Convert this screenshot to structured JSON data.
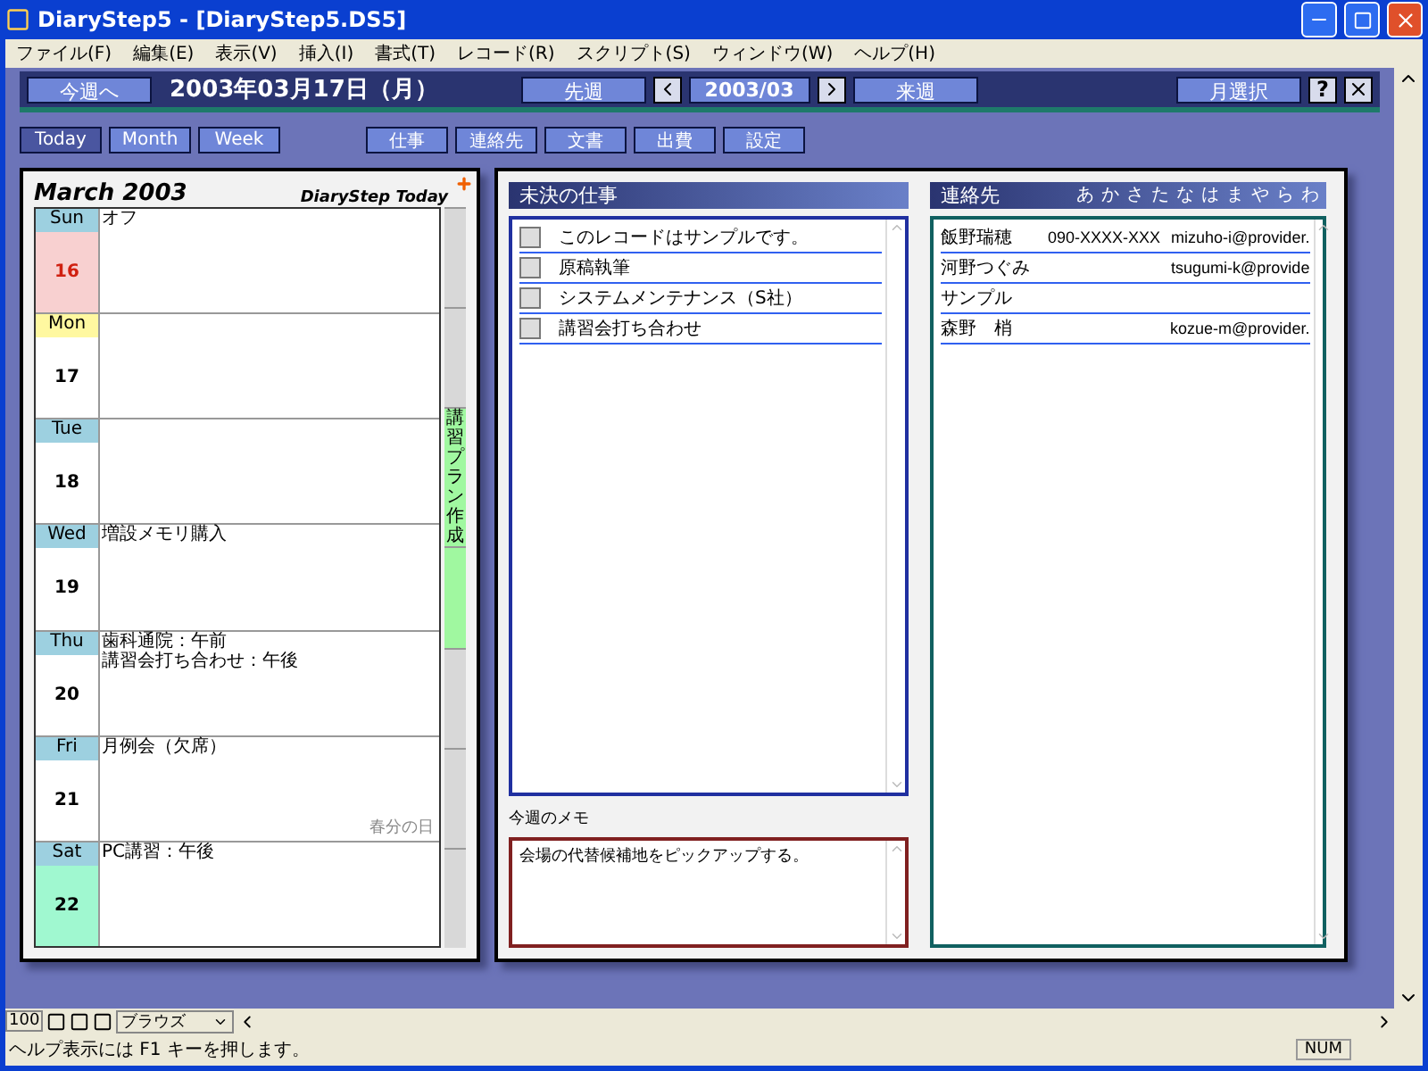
{
  "window": {
    "title": "DiaryStep5 - [DiaryStep5.DS5]"
  },
  "menu": [
    "ファイル(F)",
    "編集(E)",
    "表示(V)",
    "挿入(I)",
    "書式(T)",
    "レコード(R)",
    "スクリプト(S)",
    "ウィンドウ(W)",
    "ヘルプ(H)"
  ],
  "header": {
    "this_week": "今週へ",
    "date": "2003年03月17日（月）",
    "prev_week": "先週",
    "month": "2003/03",
    "next_week": "来週",
    "month_select": "月選択",
    "help": "?"
  },
  "view_tabs": [
    {
      "label": "Today",
      "selected": true
    },
    {
      "label": "Month",
      "selected": false
    },
    {
      "label": "Week",
      "selected": false
    }
  ],
  "sections": [
    "仕事",
    "連絡先",
    "文書",
    "出費",
    "設定"
  ],
  "calendar": {
    "title": "March 2003",
    "brand": "DiaryStep Today",
    "band_label": "講習プラン作成",
    "days": [
      {
        "weekday": "Sun",
        "date": "16",
        "kind": "sunday",
        "entries": [
          "オフ"
        ],
        "band": false
      },
      {
        "weekday": "Mon",
        "date": "17",
        "kind": "today",
        "band": false
      },
      {
        "weekday": "Tue",
        "date": "18",
        "kind": "weekday",
        "band": true
      },
      {
        "weekday": "Wed",
        "date": "19",
        "kind": "weekday",
        "entries": [
          "増設メモリ購入"
        ],
        "band": true
      },
      {
        "weekday": "Thu",
        "date": "20",
        "kind": "weekday",
        "entries": [
          "歯科通院：午前",
          "講習会打ち合わせ：午後"
        ],
        "band": false
      },
      {
        "weekday": "Fri",
        "date": "21",
        "kind": "weekday",
        "entries": [
          "月例会（欠席）"
        ],
        "holiday": "春分の日",
        "band": false
      },
      {
        "weekday": "Sat",
        "date": "22",
        "kind": "saturday",
        "entries": [
          "PC講習：午後"
        ],
        "band": false
      }
    ]
  },
  "tasks": {
    "title": "未決の仕事",
    "items": [
      {
        "label": "このレコードはサンプルです。",
        "checked": false
      },
      {
        "label": "原稿執筆",
        "checked": false
      },
      {
        "label": "システムメンテナンス（S社）",
        "checked": false
      },
      {
        "label": "講習会打ち合わせ",
        "checked": false
      }
    ]
  },
  "memo": {
    "label": "今週のメモ",
    "text": "会場の代替候補地をピックアップする。"
  },
  "contacts": {
    "title": "連絡先",
    "index": [
      "あ",
      "か",
      "さ",
      "た",
      "な",
      "は",
      "ま",
      "や",
      "ら",
      "わ"
    ],
    "rows": [
      {
        "name": "飯野瑞穂",
        "phone": "090-XXXX-XXX",
        "email": "mizuho-i@provider."
      },
      {
        "name": "河野つぐみ",
        "email": "tsugumi-k@provide"
      },
      {
        "name": "サンプル"
      },
      {
        "name": "森野　梢",
        "email": "kozue-m@provider."
      }
    ]
  },
  "bottom": {
    "zoom": "100",
    "mode": "ブラウズ"
  },
  "status_bar": {
    "text": "ヘルプ表示には F1 キーを押します。",
    "indicators": [
      "NUM"
    ]
  }
}
